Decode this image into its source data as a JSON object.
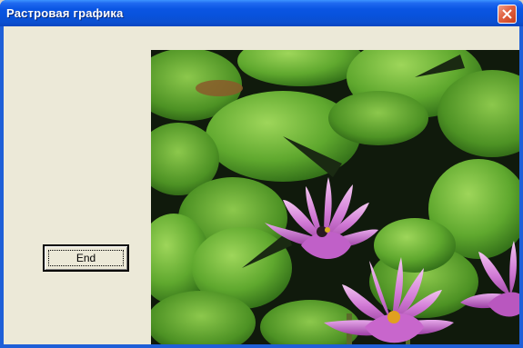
{
  "window": {
    "title": "Растровая графика"
  },
  "button": {
    "end_label": "End"
  },
  "picture": {
    "description_icon": "water-lily-photo-image"
  },
  "colors": {
    "titlebar": "#0a55e3",
    "client_background": "#ece9d8",
    "close_button": "#e0603f"
  }
}
